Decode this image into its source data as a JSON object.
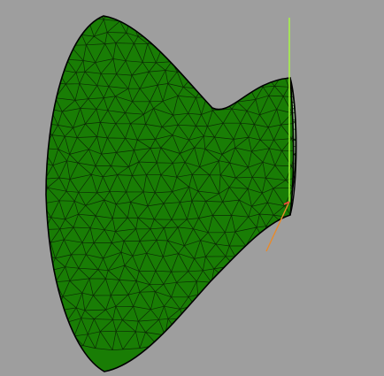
{
  "viewer": {
    "background_color": "#9e9e9e",
    "mesh": {
      "shape": "hourglass-flared-tube",
      "fill_color": "#197d05",
      "edge_color": "#0b2b05",
      "outline_color": "#000000",
      "open_end_interior_color": "#a8d29c"
    },
    "axes": {
      "up_axis_color": "#a6ff3c",
      "depth_axis_color": "#e88a2a",
      "side_axis_color": "#ff4040"
    }
  }
}
